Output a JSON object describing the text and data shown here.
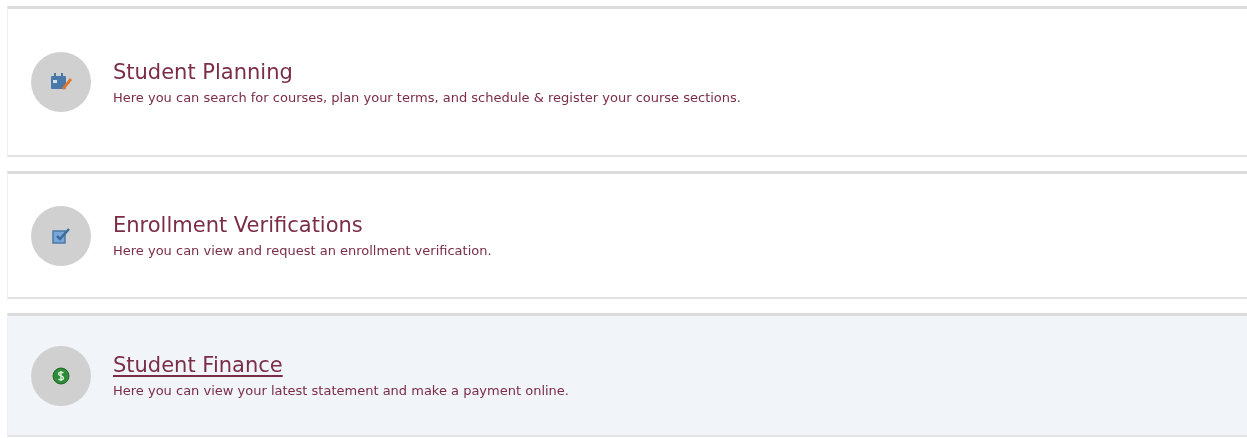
{
  "cards": [
    {
      "title": "Student Planning",
      "description": "Here you can search for courses, plan your terms, and schedule & register your course sections.",
      "selected": false
    },
    {
      "title": "Enrollment Verifications",
      "description": "Here you can view and request an enrollment verification.",
      "selected": false
    },
    {
      "title": "Student Finance",
      "description": "Here you can view your latest statement and make a payment online.",
      "selected": true
    }
  ]
}
